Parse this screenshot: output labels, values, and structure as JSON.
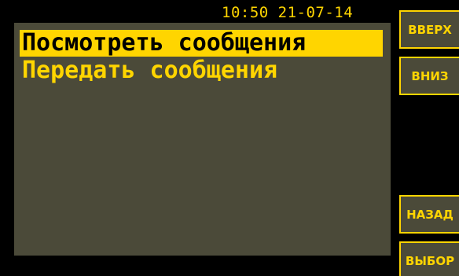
{
  "status_bar": {
    "datetime": "10:50 21-07-14"
  },
  "menu": {
    "items": [
      {
        "label": "Посмотреть сообщения",
        "selected": true
      },
      {
        "label": "Передать сообщения",
        "selected": false
      }
    ]
  },
  "softkeys": {
    "up": "ВВЕРХ",
    "down": "ВНИЗ",
    "back": "НАЗАД",
    "select": "ВЫБОР"
  },
  "colors": {
    "accent": "#ffd500",
    "panel": "#4b4a39",
    "background": "#000000"
  }
}
